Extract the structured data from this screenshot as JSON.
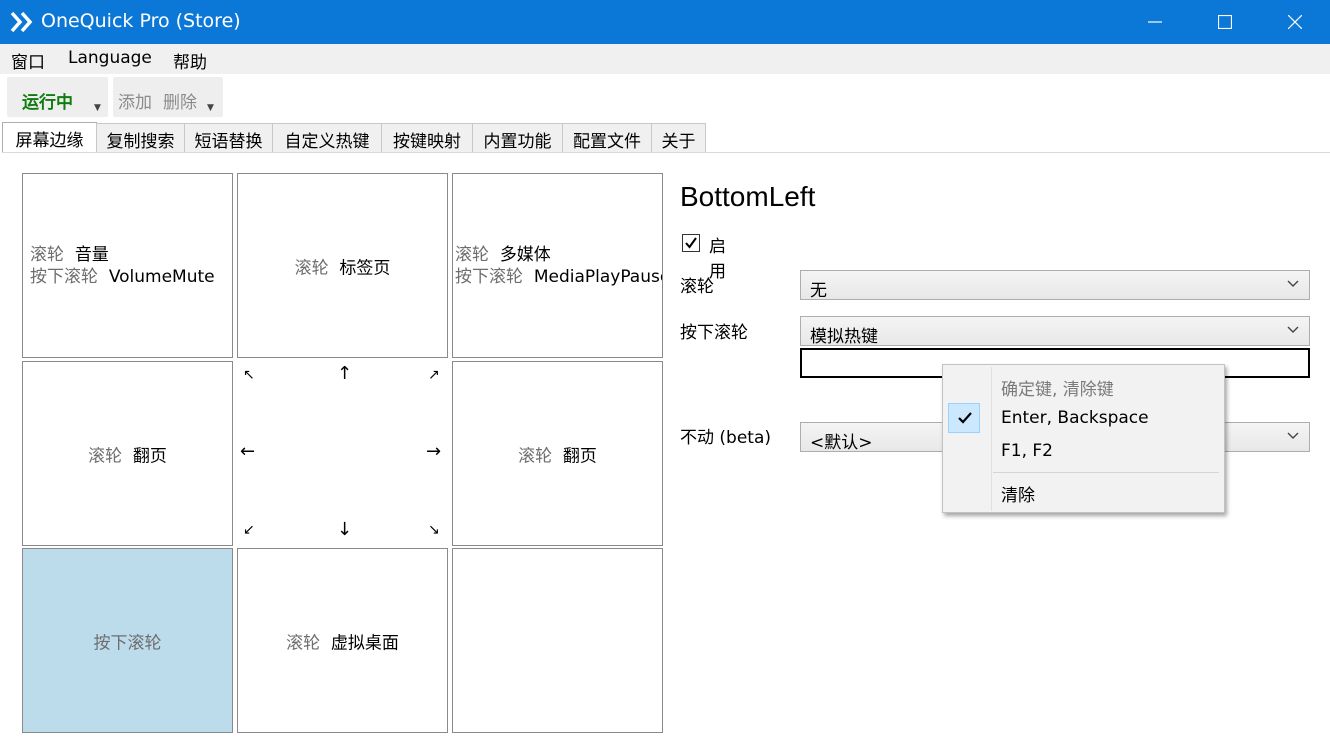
{
  "window": {
    "title": "OneQuick Pro (Store)",
    "title_bar_color": "#0b78d7"
  },
  "menu": [
    "窗口",
    "Language",
    "帮助"
  ],
  "toolbar": {
    "running_label": "运行中",
    "running_color": "#107c10",
    "add_label": "添加",
    "delete_label": "删除"
  },
  "tabs": [
    "屏幕边缘",
    "复制搜索",
    "短语替换",
    "自定义热键",
    "按键映射",
    "内置功能",
    "配置文件",
    "关于"
  ],
  "grid": {
    "top_left": {
      "line1_key": "滚轮",
      "line1_val": "音量",
      "line2_key": "按下滚轮",
      "line2_val": "VolumeMute"
    },
    "top": {
      "key": "滚轮",
      "val": "标签页"
    },
    "top_right": {
      "line1_key": "滚轮",
      "line1_val": "多媒体",
      "line2_key": "按下滚轮",
      "line2_val": "MediaPlayPause"
    },
    "left": {
      "key": "滚轮",
      "val": "翻页"
    },
    "right": {
      "key": "滚轮",
      "val": "翻页"
    },
    "bottom_left": {
      "key": "按下滚轮"
    },
    "bottom": {
      "key": "滚轮",
      "val": "虚拟桌面"
    },
    "bottom_right": {},
    "selected_color": "#bcdcec",
    "arrows": {
      "nw": "↖",
      "n": "↑",
      "ne": "↗",
      "w": "←",
      "e": "→",
      "sw": "↙",
      "s": "↓",
      "se": "↘"
    }
  },
  "panel": {
    "title": "BottomLeft",
    "enable_label": "启用",
    "enabled": true,
    "wheel_label": "滚轮",
    "wheel_value": "无",
    "press_wheel_label": "按下滚轮",
    "press_wheel_value": "模拟热键",
    "hotkey_input_value": "",
    "idle_label": "不动 (beta)",
    "idle_value": "<默认>"
  },
  "context_menu": {
    "items": [
      {
        "label": "确定键, 清除键",
        "disabled": true
      },
      {
        "label": "Enter, Backspace",
        "checked": true
      },
      {
        "label": "F1, F2"
      },
      {
        "label": "清除"
      }
    ]
  }
}
